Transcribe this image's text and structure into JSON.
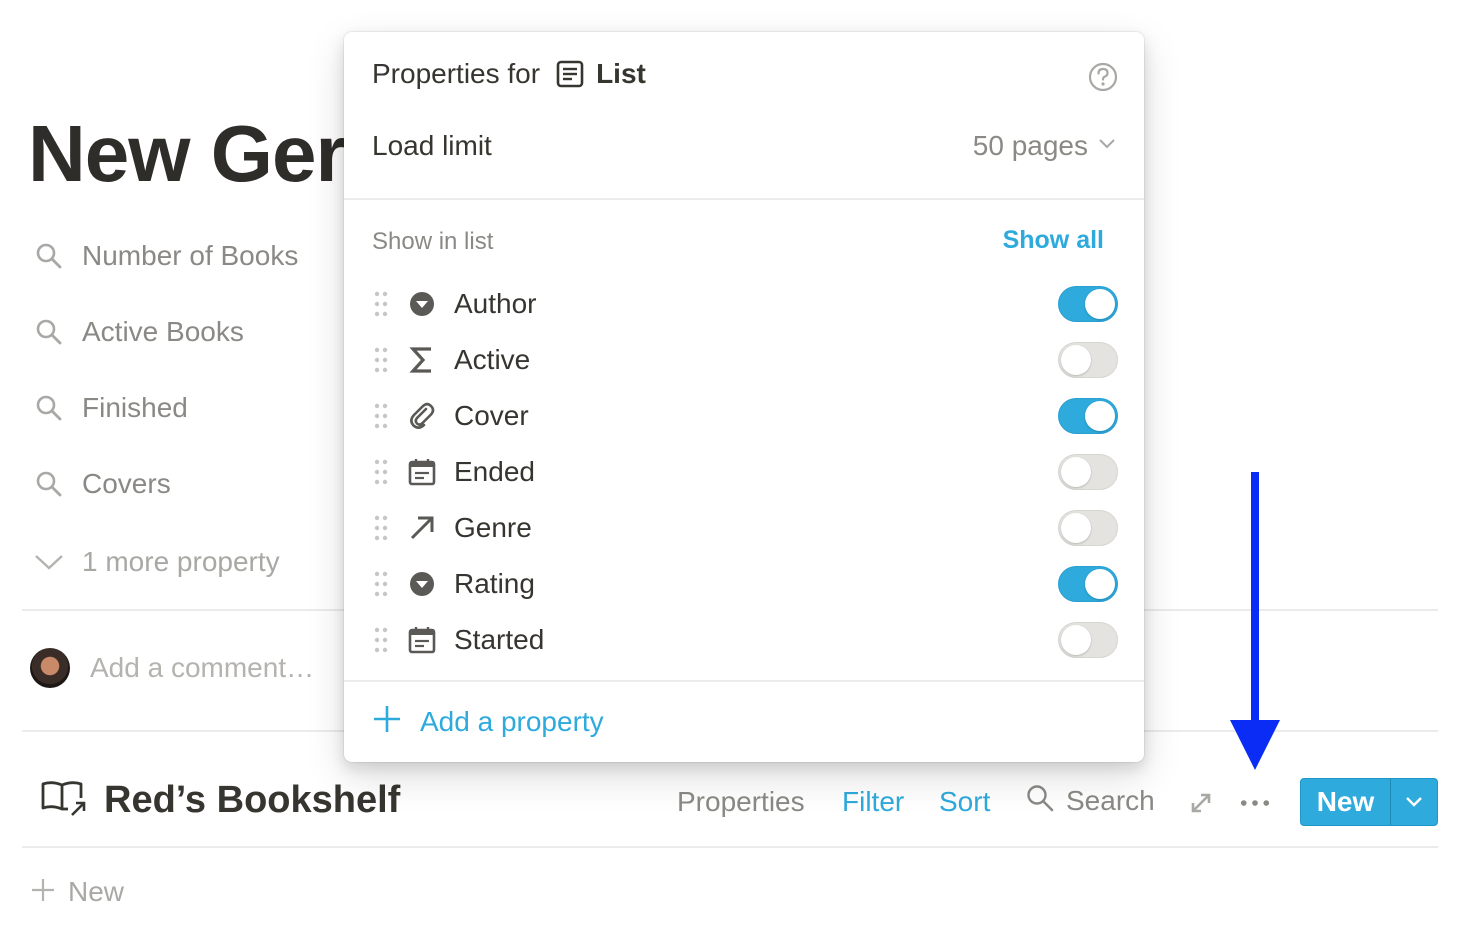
{
  "page": {
    "title": "New Ger"
  },
  "properties": [
    {
      "label": "Number of Books",
      "icon": "search-icon"
    },
    {
      "label": "Active Books",
      "icon": "search-icon"
    },
    {
      "label": "Finished",
      "icon": "search-icon"
    },
    {
      "label": "Covers",
      "icon": "search-icon"
    }
  ],
  "more_properties_label": "1 more property",
  "comment": {
    "placeholder": "Add a comment…"
  },
  "database": {
    "title": "Red’s Bookshelf",
    "toolbar": {
      "properties": "Properties",
      "filter": "Filter",
      "sort": "Sort",
      "search": "Search",
      "new": "New"
    },
    "add_new": "New"
  },
  "popup": {
    "header_prefix": "Properties for",
    "view_name": "List",
    "load_limit_label": "Load limit",
    "load_limit_value": "50 pages",
    "section_label": "Show in list",
    "show_all": "Show all",
    "items": [
      {
        "name": "Author",
        "icon": "select-icon",
        "visible": true
      },
      {
        "name": "Active",
        "icon": "formula-icon",
        "visible": false
      },
      {
        "name": "Cover",
        "icon": "paperclip-icon",
        "visible": true
      },
      {
        "name": "Ended",
        "icon": "calendar-icon",
        "visible": false
      },
      {
        "name": "Genre",
        "icon": "relation-arrow-icon",
        "visible": false
      },
      {
        "name": "Rating",
        "icon": "select-icon",
        "visible": true
      },
      {
        "name": "Started",
        "icon": "calendar-icon",
        "visible": false
      }
    ],
    "add_property": "Add a property"
  },
  "colors": {
    "accent": "#2eaadc",
    "annotation_arrow": "#0a2cf5",
    "text": "#37352f",
    "muted": "#8a8985"
  }
}
